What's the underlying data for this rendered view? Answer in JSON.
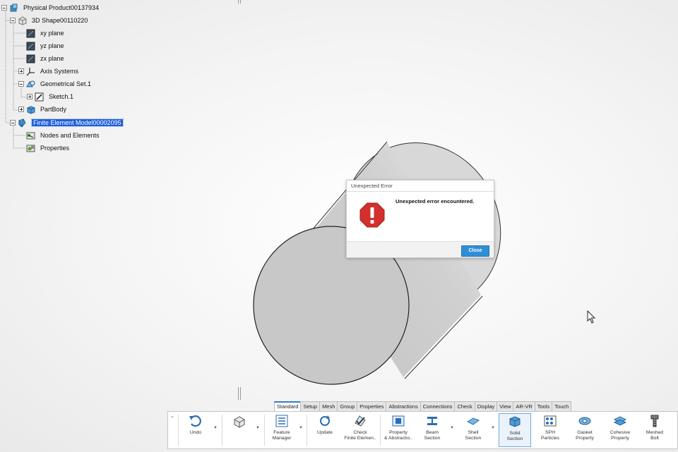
{
  "tree": {
    "items": [
      {
        "label": "Physical Product00137934",
        "selected": false
      },
      {
        "label": "3D Shape00110220",
        "selected": false
      },
      {
        "label": "xy plane",
        "selected": false
      },
      {
        "label": "yz plane",
        "selected": false
      },
      {
        "label": "zx plane",
        "selected": false
      },
      {
        "label": "Axis Systems",
        "selected": false
      },
      {
        "label": "Geometrical Set.1",
        "selected": false
      },
      {
        "label": "Sketch.1",
        "selected": false
      },
      {
        "label": "PartBody",
        "selected": false
      },
      {
        "label": "Finite Element Model00002095",
        "selected": true
      },
      {
        "label": "Nodes and Elements",
        "selected": false
      },
      {
        "label": "Properties",
        "selected": false
      }
    ]
  },
  "dialog": {
    "title": "Unexpected Error",
    "message": "Unexpected error encountered.",
    "close_label": "Close",
    "icon": "error-icon"
  },
  "ribbon": {
    "tabs": [
      {
        "label": "Standard",
        "active": true
      },
      {
        "label": "Setup",
        "active": false
      },
      {
        "label": "Mesh",
        "active": false
      },
      {
        "label": "Group",
        "active": false
      },
      {
        "label": "Properties",
        "active": false
      },
      {
        "label": "Abstractions",
        "active": false
      },
      {
        "label": "Connections",
        "active": false
      },
      {
        "label": "Check",
        "active": false
      },
      {
        "label": "Display",
        "active": false
      },
      {
        "label": "View",
        "active": false
      },
      {
        "label": "AR-VR",
        "active": false
      },
      {
        "label": "Tools",
        "active": false
      },
      {
        "label": "Touch",
        "active": false
      }
    ],
    "buttons": [
      {
        "label1": "Undo",
        "label2": "",
        "icon": "undo-icon"
      },
      {
        "label1": "",
        "label2": "",
        "icon": "part-shape-icon"
      },
      {
        "label1": "Feature",
        "label2": "Manager",
        "icon": "feature-manager-icon"
      },
      {
        "label1": "Update",
        "label2": "",
        "icon": "update-icon"
      },
      {
        "label1": "Check",
        "label2": "Finite Elemen..",
        "icon": "check-fe-icon"
      },
      {
        "label1": "Property",
        "label2": "& Abstractio..",
        "icon": "property-icon"
      },
      {
        "label1": "Beam",
        "label2": "Section",
        "icon": "beam-section-icon"
      },
      {
        "label1": "Shell",
        "label2": "Section",
        "icon": "shell-section-icon"
      },
      {
        "label1": "Solid",
        "label2": "Section",
        "icon": "solid-section-icon",
        "active": true
      },
      {
        "label1": "SPH",
        "label2": "Particles",
        "icon": "sph-particles-icon"
      },
      {
        "label1": "Gasket",
        "label2": "Property",
        "icon": "gasket-property-icon"
      },
      {
        "label1": "Cohesive",
        "label2": "Property",
        "icon": "cohesive-property-icon"
      },
      {
        "label1": "Meshed",
        "label2": "Bolt",
        "icon": "meshed-bolt-icon"
      }
    ]
  },
  "colors": {
    "selection": "#1e5fd8",
    "accent": "#2f8fd6",
    "error": "#d32f2f",
    "cylinder": "#c8c8c8"
  }
}
